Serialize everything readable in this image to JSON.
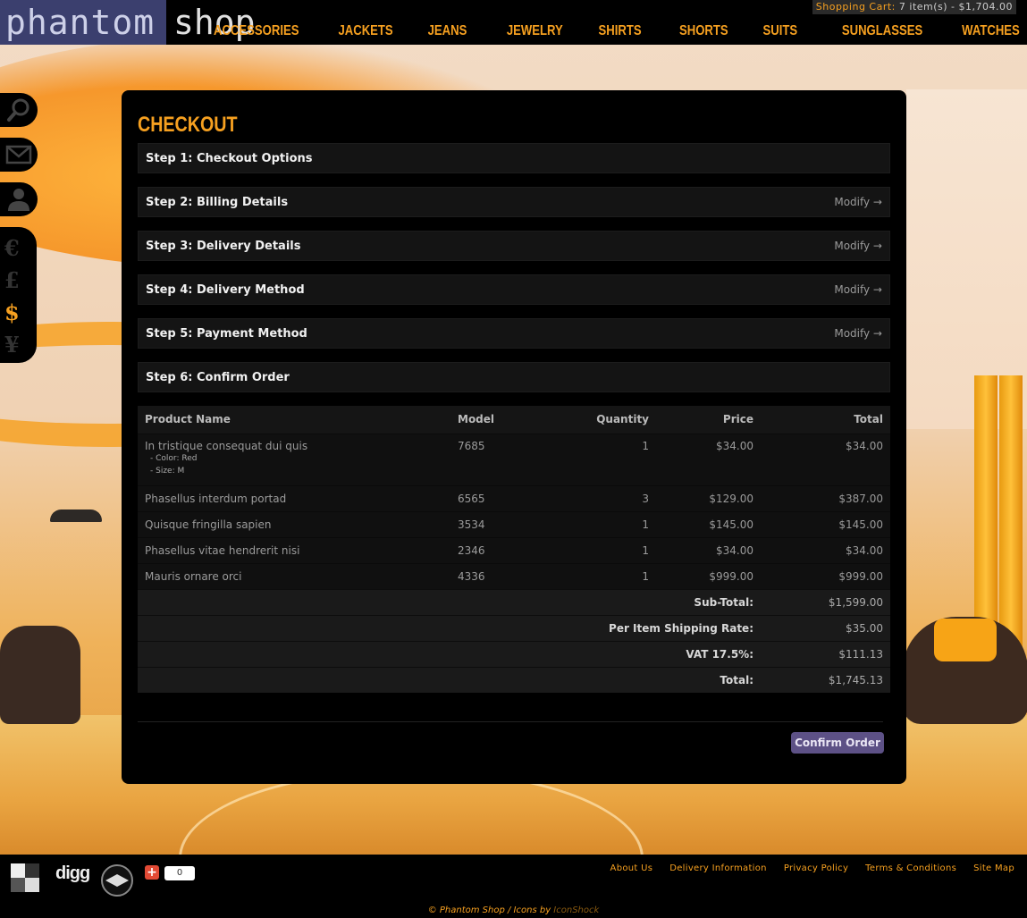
{
  "brand": {
    "name_a": "phantom",
    "name_b": "shop"
  },
  "cart": {
    "label": "Shopping Cart:",
    "summary": "7 item(s) - $1,704.00"
  },
  "nav": [
    "ACCESSORIES",
    "JACKETS",
    "JEANS",
    "JEWELRY",
    "SHIRTS",
    "SHORTS",
    "SUITS",
    "SUNGLASSES",
    "WATCHES"
  ],
  "side_tools": [
    "search-icon",
    "mail-icon",
    "user-icon"
  ],
  "currencies": [
    "€",
    "£",
    "$",
    "¥"
  ],
  "active_currency": "$",
  "checkout": {
    "title": "CHECKOUT",
    "steps": [
      {
        "label": "Step 1: Checkout Options",
        "modify": ""
      },
      {
        "label": "Step 2: Billing Details",
        "modify": "Modify →"
      },
      {
        "label": "Step 3: Delivery Details",
        "modify": "Modify →"
      },
      {
        "label": "Step 4: Delivery Method",
        "modify": "Modify →"
      },
      {
        "label": "Step 5: Payment Method",
        "modify": "Modify →"
      },
      {
        "label": "Step 6: Confirm Order",
        "modify": ""
      }
    ],
    "columns": [
      "Product Name",
      "Model",
      "Quantity",
      "Price",
      "Total"
    ],
    "products": [
      {
        "name": "In tristique consequat dui quis",
        "options": [
          "- Color: Red",
          "- Size: M"
        ],
        "model": "7685",
        "qty": "1",
        "price": "$34.00",
        "total": "$34.00"
      },
      {
        "name": "Phasellus interdum portad",
        "options": [],
        "model": "6565",
        "qty": "3",
        "price": "$129.00",
        "total": "$387.00"
      },
      {
        "name": "Quisque fringilla sapien",
        "options": [],
        "model": "3534",
        "qty": "1",
        "price": "$145.00",
        "total": "$145.00"
      },
      {
        "name": "Phasellus vitae hendrerit nisi",
        "options": [],
        "model": "2346",
        "qty": "1",
        "price": "$34.00",
        "total": "$34.00"
      },
      {
        "name": "Mauris ornare orci",
        "options": [],
        "model": "4336",
        "qty": "1",
        "price": "$999.00",
        "total": "$999.00"
      }
    ],
    "totals": [
      {
        "label": "Sub-Total:",
        "value": "$1,599.00"
      },
      {
        "label": "Per Item Shipping Rate:",
        "value": "$35.00"
      },
      {
        "label": "VAT 17.5%:",
        "value": "$111.13"
      },
      {
        "label": "Total:",
        "value": "$1,745.13"
      }
    ],
    "confirm_label": "Confirm Order"
  },
  "footer": {
    "digg": "digg",
    "share_count": "0",
    "links": [
      "About Us",
      "Delivery Information",
      "Privacy Policy",
      "Terms & Conditions",
      "Site Map"
    ],
    "copyright": "© Phantom Shop / Icons by ",
    "copyright_credit": "IconShock"
  },
  "colors": {
    "accent": "#f6a020",
    "button": "#5d5186",
    "panel": "#000000"
  }
}
